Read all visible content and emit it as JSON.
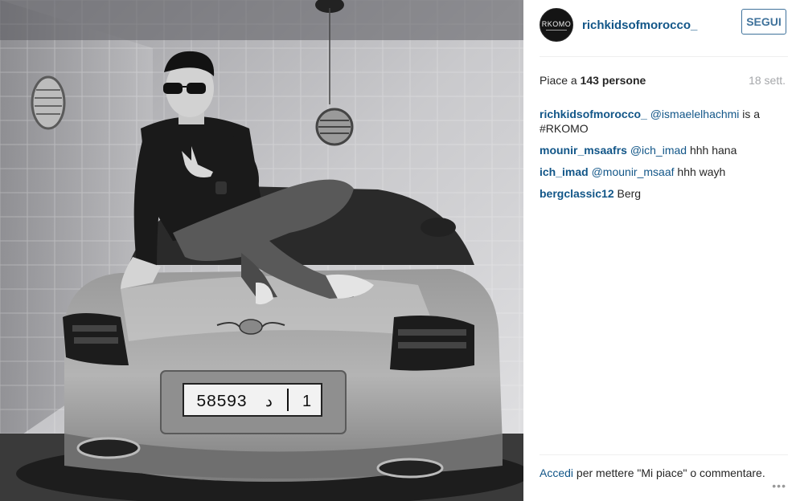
{
  "post": {
    "username": "richkidsofmorocco_",
    "avatar_text": "RKOMO",
    "follow_label": "SEGUI",
    "likes_prefix": "Piace a ",
    "likes_count": "143",
    "likes_suffix": " persone",
    "time": "18 sett.",
    "plate_number": "58593",
    "plate_letter": "د",
    "plate_digit": "1"
  },
  "comments": [
    {
      "author": "richkidsofmorocco_",
      "mention": "@ismaelelhachmi",
      "text": " is a #RKOMO"
    },
    {
      "author": "mounir_msaafrs",
      "mention": "@ich_imad",
      "text": " hhh hana"
    },
    {
      "author": "ich_imad",
      "mention": "@mounir_msaaf",
      "text": " hhh wayh"
    },
    {
      "author": "bergclassic12",
      "mention": "",
      "text": "Berg"
    }
  ],
  "footer": {
    "login_link": "Accedi",
    "login_text": " per mettere \"Mi piace\" o commentare.",
    "more_icon": "ellipsis-icon"
  },
  "colors": {
    "link": "#125688",
    "follow_border": "#3f729b",
    "muted": "#a5a7aa"
  }
}
